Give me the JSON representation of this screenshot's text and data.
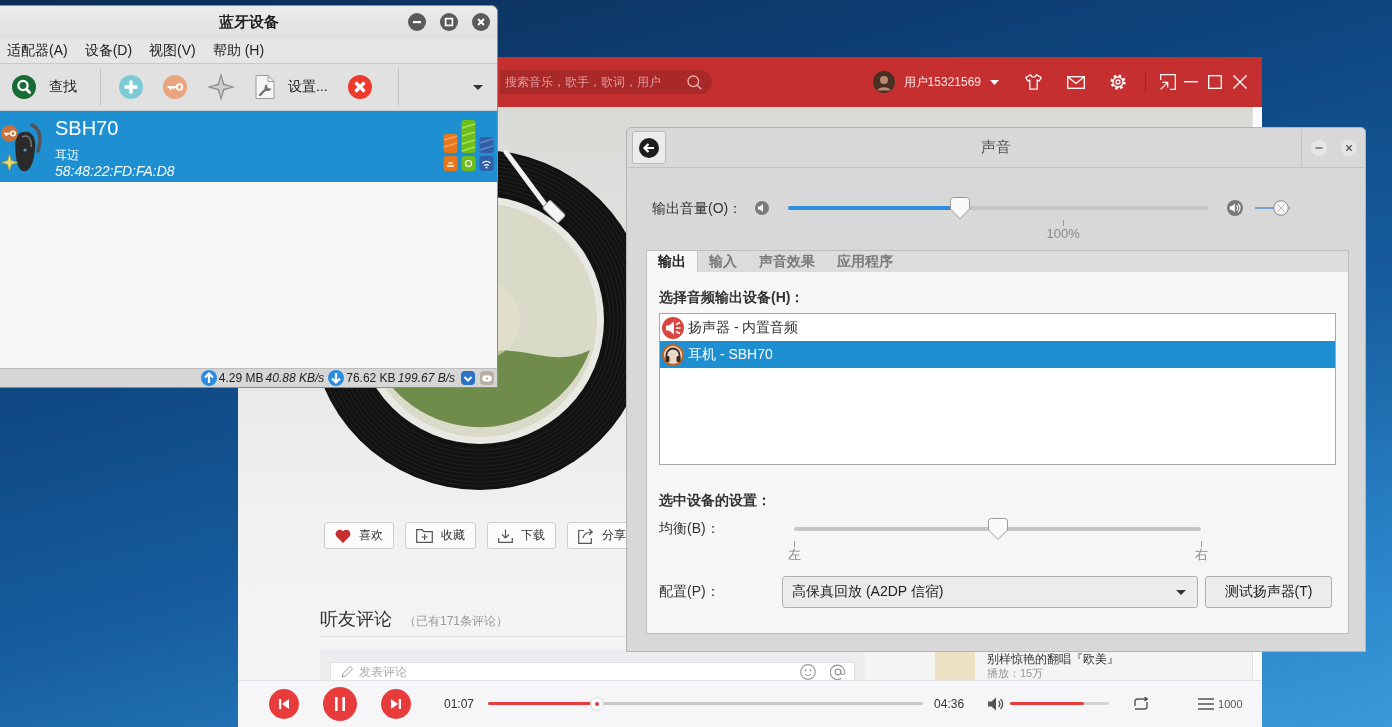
{
  "bluetooth_window": {
    "title": "蓝牙设备",
    "menu": [
      "适配器(A)",
      "设备(D)",
      "视图(V)",
      "帮助 (H)"
    ],
    "toolbar": [
      {
        "kind": "search",
        "label": "查找"
      },
      {
        "kind": "add"
      },
      {
        "kind": "pair"
      },
      {
        "kind": "trust"
      },
      {
        "kind": "setup",
        "label": "设置..."
      },
      {
        "kind": "remove"
      }
    ],
    "devices": [
      {
        "name": "SBH70",
        "type": "耳迈",
        "address": "58:48:22:FD:FA:D8",
        "selected": true,
        "paired": true,
        "trusted": true
      }
    ],
    "status_bar": {
      "uploaded": "4.29 MB",
      "upload_rate": "40.88 KB/s",
      "downloaded": "76.62 KB",
      "download_rate": "199.67 B/s"
    }
  },
  "music_window": {
    "search": {
      "placeholder": "搜索音乐，歌手，歌词，用户"
    },
    "user": {
      "name": "用户15321569"
    },
    "actions": [
      {
        "kind": "like",
        "label": "喜欢"
      },
      {
        "kind": "collect",
        "label": "收藏"
      },
      {
        "kind": "download",
        "label": "下载"
      },
      {
        "kind": "share",
        "label": "分享"
      }
    ],
    "comments": {
      "title": "听友评论",
      "count": "（已有171条评论）",
      "placeholder": "发表评论"
    },
    "related": [
      {
        "title": "别样惊艳的翻唱『欧美』",
        "plays": "播放：15万"
      }
    ],
    "player": {
      "playing": true,
      "elapsed": "01:07",
      "duration": "04:36",
      "progress": {
        "level": 0.25
      },
      "volume": {
        "level": 0.75
      },
      "playlist_count": "1000"
    }
  },
  "sound_dialog": {
    "title": "声音",
    "output_volume": {
      "label": "输出音量(O)：",
      "level": 0.41,
      "scale_label": "100%"
    },
    "tabs": [
      {
        "label": "输出",
        "selected": true
      },
      {
        "label": "输入",
        "selected": false
      },
      {
        "label": "声音效果",
        "selected": false
      },
      {
        "label": "应用程序",
        "selected": false
      }
    ],
    "device_list_label": "选择音频输出设备(H)：",
    "devices": [
      {
        "kind": "speaker",
        "label": "扬声器 - 内置音频",
        "selected": false
      },
      {
        "kind": "headphones",
        "label": "耳机 - SBH70",
        "selected": true
      }
    ],
    "settings_label": "选中设备的设置：",
    "balance": {
      "label": "均衡(B)：",
      "level": 0.5,
      "left_label": "左",
      "right_label": "右"
    },
    "profile": {
      "label": "配置(P)：",
      "value": "高保真回放 (A2DP 信宿)"
    },
    "test_button": "测试扬声器(T)"
  }
}
